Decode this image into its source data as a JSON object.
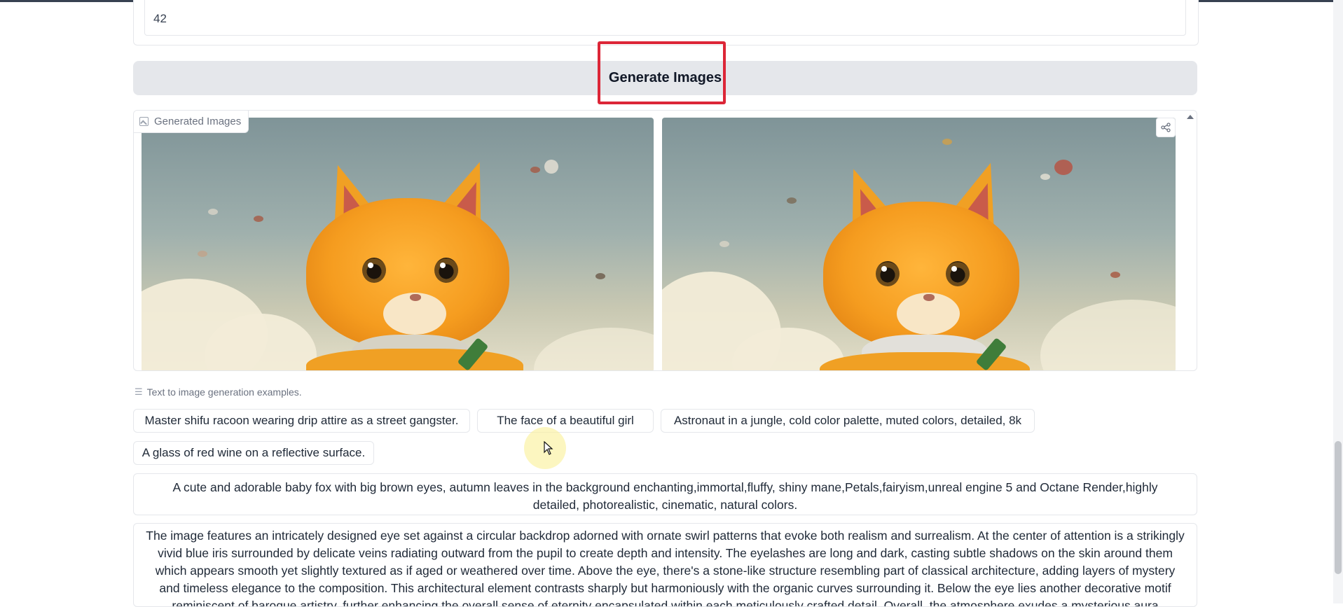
{
  "seed": {
    "value": "42"
  },
  "generate_button": {
    "label": "Generate Images"
  },
  "gallery": {
    "label": "Generated Images",
    "label_icon": "image-icon",
    "share_icon": "share-icon",
    "images": [
      {
        "alt": "Generated image 1"
      },
      {
        "alt": "Generated image 2"
      }
    ]
  },
  "examples": {
    "label": "Text to image generation examples.",
    "label_icon": "list-icon",
    "chips": [
      "Master shifu racoon wearing drip attire as a street gangster.",
      "The face of a beautiful girl",
      "Astronaut in a jungle, cold color palette, muted colors, detailed, 8k",
      "A glass of red wine on a reflective surface."
    ],
    "prompt_fox": "A cute and adorable baby fox with big brown eyes, autumn leaves in the background enchanting,immortal,fluffy, shiny mane,Petals,fairyism,unreal engine 5 and Octane Render,highly detailed, photorealistic, cinematic, natural colors.",
    "prompt_eye": "The image features an intricately designed eye set against a circular backdrop adorned with ornate swirl patterns that evoke both realism and surrealism. At the center of attention is a strikingly vivid blue iris surrounded by delicate veins radiating outward from the pupil to create depth and intensity. The eyelashes are long and dark, casting subtle shadows on the skin around them which appears smooth yet slightly textured as if aged or weathered over time. Above the eye, there's a stone-like structure resembling part of classical architecture, adding layers of mystery and timeless elegance to the composition. This architectural element contrasts sharply but harmoniously with the organic curves surrounding it. Below the eye lies another decorative motif reminiscent of baroque artistry, further enhancing the overall sense of eternity encapsulated within each meticulously crafted detail. Overall, the atmosphere exudes a mysterious aura intertwined"
  },
  "colors": {
    "highlight": "#dc2637",
    "button_bg": "#e5e7eb"
  }
}
